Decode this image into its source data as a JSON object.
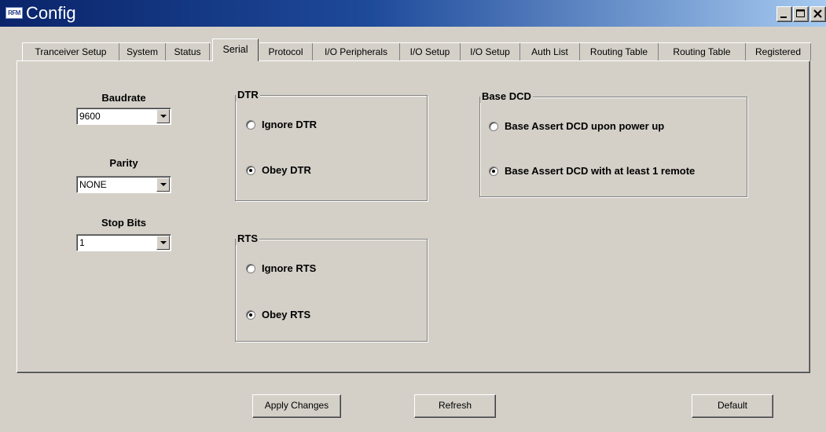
{
  "window": {
    "title": "Config",
    "icon_text": "RFM",
    "controls": [
      "minimize",
      "maximize",
      "close"
    ]
  },
  "tabs": [
    {
      "label": "Tranceiver Setup",
      "active": false
    },
    {
      "label": "System",
      "active": false
    },
    {
      "label": "Status",
      "active": false
    },
    {
      "label": "Serial",
      "active": true
    },
    {
      "label": "Protocol",
      "active": false
    },
    {
      "label": "I/O Peripherals",
      "active": false
    },
    {
      "label": "I/O Setup",
      "active": false
    },
    {
      "label": "I/O Setup",
      "active": false
    },
    {
      "label": "Auth List",
      "active": false
    },
    {
      "label": "Routing Table",
      "active": false
    },
    {
      "label": "Routing Table",
      "active": false
    },
    {
      "label": "Registered",
      "active": false
    }
  ],
  "serial": {
    "baudrate": {
      "label": "Baudrate",
      "value": "9600"
    },
    "parity": {
      "label": "Parity",
      "value": "NONE"
    },
    "stop_bits": {
      "label": "Stop Bits",
      "value": "1"
    },
    "dtr": {
      "title": "DTR",
      "options": [
        {
          "label": "Ignore DTR",
          "checked": false
        },
        {
          "label": "Obey DTR",
          "checked": true
        }
      ]
    },
    "rts": {
      "title": "RTS",
      "options": [
        {
          "label": "Ignore RTS",
          "checked": false
        },
        {
          "label": "Obey RTS",
          "checked": true
        }
      ]
    },
    "base_dcd": {
      "title": "Base DCD",
      "options": [
        {
          "label": "Base Assert DCD upon power up",
          "checked": false
        },
        {
          "label": "Base Assert DCD with at least 1 remote",
          "checked": true
        }
      ]
    }
  },
  "buttons": {
    "apply": "Apply Changes",
    "refresh": "Refresh",
    "default": "Default"
  }
}
